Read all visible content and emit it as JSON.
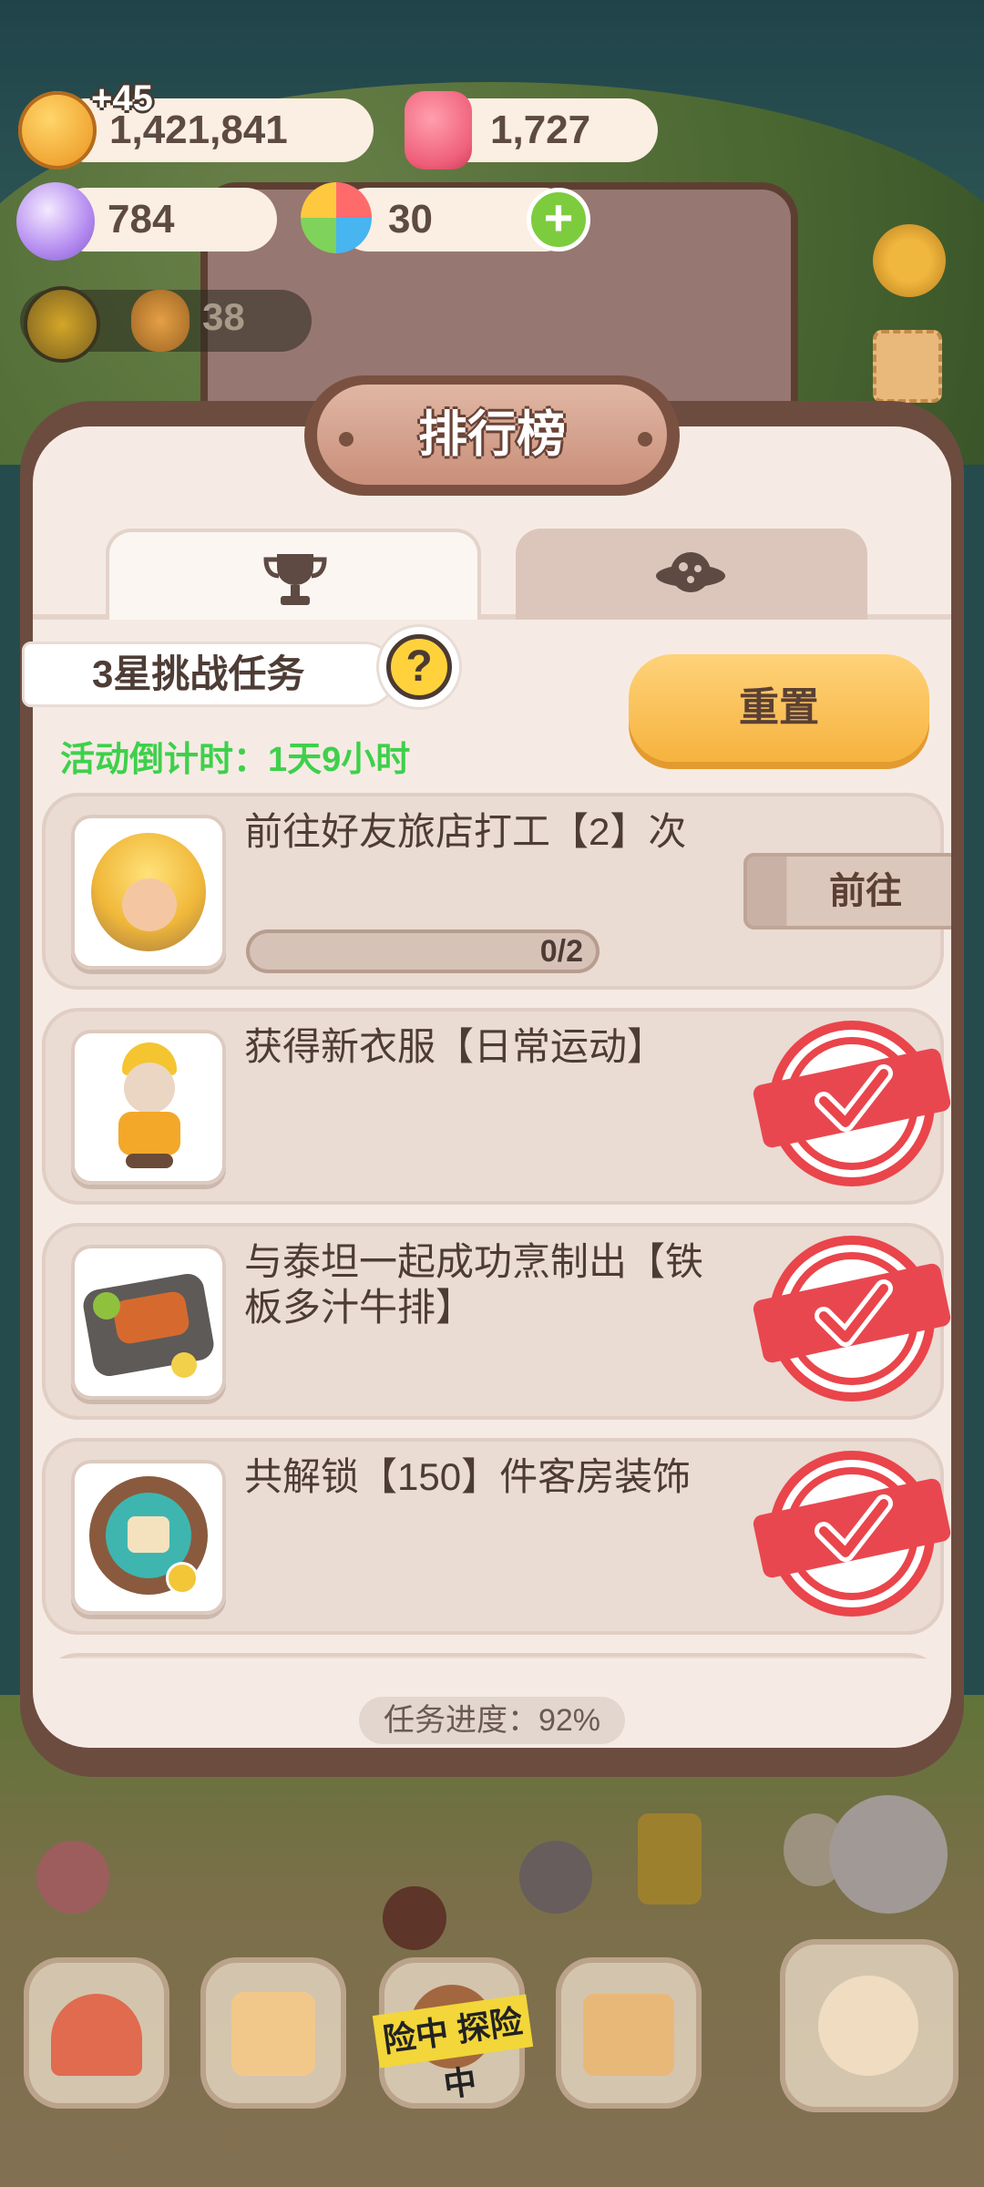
{
  "hud": {
    "gold": "1,421,841",
    "gold_gain": "+45",
    "ruby": "1,727",
    "candy": "784",
    "flower": "30",
    "add": "+",
    "level": "38"
  },
  "panel": {
    "title": "排行榜",
    "tabs": [
      {
        "icon": "trophy-icon",
        "active": true
      },
      {
        "icon": "planet-icon",
        "active": false
      }
    ],
    "challenge_title": "3星挑战任务",
    "help": "?",
    "countdown": "活动倒计时：1天9小时",
    "reset_label": "重置",
    "tasks": [
      {
        "text": "前往好友旅店打工【2】次",
        "progress": "0/2",
        "progress_fraction": 0,
        "action": "前往",
        "done": false,
        "icon": "worker-girl-icon"
      },
      {
        "text": "获得新衣服【日常运动】",
        "done": true,
        "icon": "outfit-icon"
      },
      {
        "text": "与泰坦一起成功烹制出【铁板多汁牛排】",
        "done": true,
        "icon": "steak-icon"
      },
      {
        "text": "共解锁【150】件客房装饰",
        "done": true,
        "icon": "decoration-badge-icon"
      }
    ],
    "progress_text": "任务进度：92%"
  },
  "nav": {
    "adventure_label": "险中 探险中"
  },
  "colors": {
    "accent_green": "#3ed04b",
    "reset_yellow": "#f6b33e",
    "stamp_red": "#e9454b",
    "panel_border": "#6d4c40"
  }
}
